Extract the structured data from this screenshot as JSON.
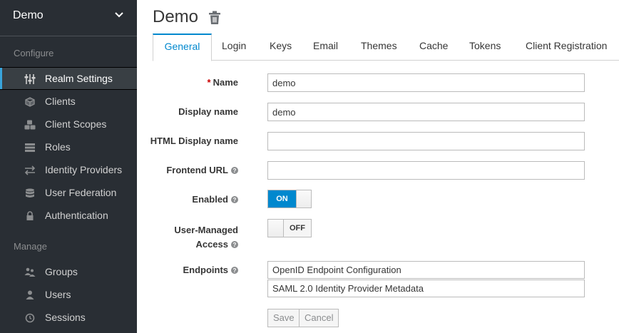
{
  "sidebar": {
    "realm": "Demo",
    "configure_label": "Configure",
    "manage_label": "Manage",
    "configure_items": [
      {
        "label": "Realm Settings",
        "icon": "sliders-icon",
        "active": true
      },
      {
        "label": "Clients",
        "icon": "cube-icon"
      },
      {
        "label": "Client Scopes",
        "icon": "cubes-icon"
      },
      {
        "label": "Roles",
        "icon": "list-icon"
      },
      {
        "label": "Identity Providers",
        "icon": "exchange-icon"
      },
      {
        "label": "User Federation",
        "icon": "database-icon"
      },
      {
        "label": "Authentication",
        "icon": "lock-icon"
      }
    ],
    "manage_items": [
      {
        "label": "Groups",
        "icon": "users-icon"
      },
      {
        "label": "Users",
        "icon": "user-icon"
      },
      {
        "label": "Sessions",
        "icon": "clock-icon"
      }
    ]
  },
  "header": {
    "title": "Demo"
  },
  "tabs": [
    "General",
    "Login",
    "Keys",
    "Email",
    "Themes",
    "Cache",
    "Tokens",
    "Client Registration"
  ],
  "form": {
    "name_label": "Name",
    "required_mark": "*",
    "name_value": "demo",
    "display_name_label": "Display name",
    "display_name_value": "demo",
    "html_display_name_label": "HTML Display name",
    "html_display_name_value": "",
    "frontend_url_label": "Frontend URL",
    "frontend_url_value": "",
    "enabled_label": "Enabled",
    "enabled_state": "ON",
    "user_managed_label_line1": "User-Managed",
    "user_managed_label_line2": "Access",
    "user_managed_state": "OFF",
    "endpoints_label": "Endpoints",
    "endpoints": [
      "OpenID Endpoint Configuration",
      "SAML 2.0 Identity Provider Metadata"
    ]
  },
  "buttons": {
    "save": "Save",
    "cancel": "Cancel"
  },
  "colors": {
    "sidebar_bg": "#292e34",
    "accent": "#0088ce",
    "active_bar": "#39a5dc",
    "required": "#cc0000"
  }
}
